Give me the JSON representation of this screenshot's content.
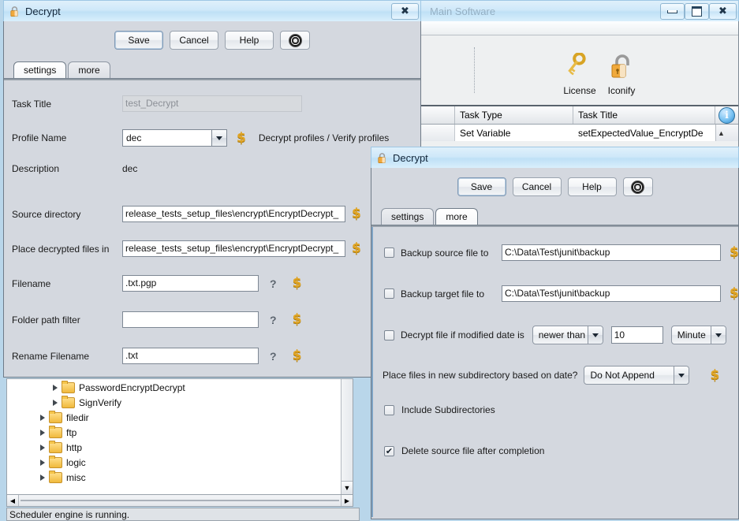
{
  "main_window": {
    "title": "Main Software",
    "window_buttons": [
      "minimize",
      "maximize",
      "close"
    ],
    "toolbar": {
      "items": [
        {
          "label": "License",
          "icon": "key-icon"
        },
        {
          "label": "Iconify",
          "icon": "padlock-icon"
        }
      ]
    },
    "task_table": {
      "columns": [
        "Task Type",
        "Task Title"
      ],
      "rows": [
        {
          "task_type": "Set Variable",
          "task_title": "setExpectedValue_EncryptDe"
        }
      ],
      "info_icon": "info-icon"
    },
    "tree": {
      "nodes": [
        {
          "label": "PasswordEncryptDecrypt",
          "indent": 2
        },
        {
          "label": "SignVerify",
          "indent": 2
        },
        {
          "label": "filedir",
          "indent": 1
        },
        {
          "label": "ftp",
          "indent": 1
        },
        {
          "label": "http",
          "indent": 1
        },
        {
          "label": "logic",
          "indent": 1
        },
        {
          "label": "misc",
          "indent": 1
        }
      ]
    },
    "status_bar": "Scheduler engine is running."
  },
  "dialog_settings": {
    "title": "Decrypt",
    "icon": "padlock-icon",
    "close_label": "✕",
    "buttons": {
      "save": "Save",
      "cancel": "Cancel",
      "help": "Help",
      "target_icon": "target-icon"
    },
    "tabs": [
      {
        "label": "settings",
        "selected": true
      },
      {
        "label": "more",
        "selected": false
      }
    ],
    "fields": {
      "task_title_label": "Task Title",
      "task_title_value": "test_Decrypt",
      "profile_name_label": "Profile Name",
      "profile_name_value": "dec",
      "profile_hint": "Decrypt profiles / Verify profiles",
      "description_label": "Description",
      "description_value": "dec",
      "source_directory_label": "Source directory",
      "source_directory_value": "_release_tests_setup_files\\encrypt\\EncryptDecrypt",
      "place_decrypted_label": "Place decrypted files in",
      "place_decrypted_value": "_release_tests_setup_files\\encrypt\\EncryptDecrypt",
      "filename_label": "Filename",
      "filename_value": ".txt.pgp",
      "folder_path_filter_label": "Folder path filter",
      "folder_path_filter_value": "",
      "rename_filename_label": "Rename Filename",
      "rename_filename_value": ".txt",
      "help_marker": "?",
      "variable_marker": "$"
    }
  },
  "dialog_more": {
    "title": "Decrypt",
    "icon": "padlock-icon",
    "buttons": {
      "save": "Save",
      "cancel": "Cancel",
      "help": "Help",
      "target_icon": "target-icon"
    },
    "tabs": [
      {
        "label": "settings",
        "selected": false
      },
      {
        "label": "more",
        "selected": true
      }
    ],
    "fields": {
      "backup_source_label": "Backup source file to",
      "backup_source_checked": false,
      "backup_source_value": "C:\\Data\\Test\\junit\\backup",
      "backup_target_label": "Backup target file to",
      "backup_target_checked": false,
      "backup_target_value": "C:\\Data\\Test\\junit\\backup",
      "modified_date_label": "Decrypt file if modified date is",
      "modified_date_checked": false,
      "modified_date_comparison": "newer than",
      "modified_date_amount": "10",
      "modified_date_unit": "Minute",
      "subdirectory_label": "Place files in new subdirectory based on date?",
      "subdirectory_value": "Do Not Append",
      "include_subdirectories_label": "Include Subdirectories",
      "include_subdirectories_checked": false,
      "delete_source_label": "Delete source file after completion",
      "delete_source_checked": true,
      "variable_marker": "$"
    }
  },
  "colors": {
    "dialog_background": "#d4d8df",
    "title_bar": "#cfe8f9",
    "gold": "#e0a423",
    "folder": "#f0b93c",
    "desktop": "#b9d6ea"
  }
}
